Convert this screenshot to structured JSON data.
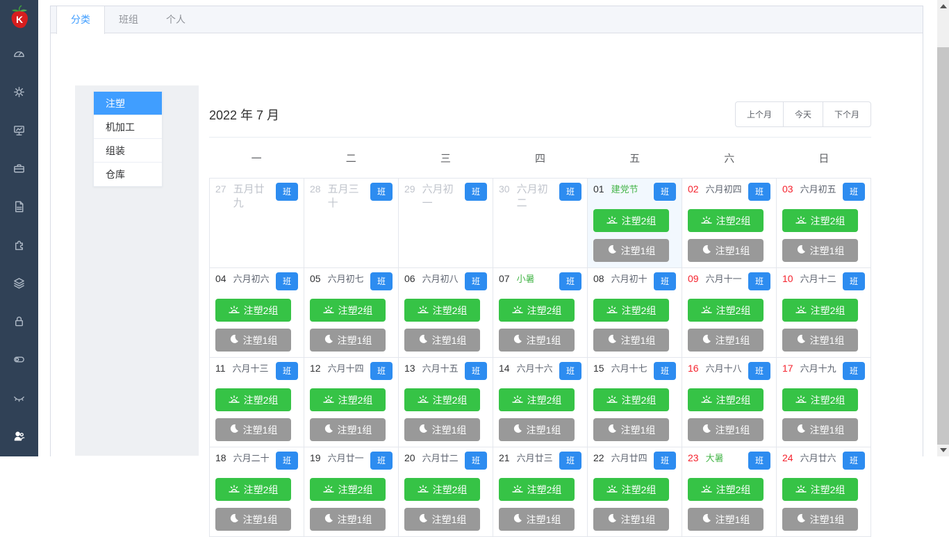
{
  "app": {
    "logo": "strawberry-logo"
  },
  "sidebar": {
    "icons": [
      {
        "name": "dashboard"
      },
      {
        "name": "settings"
      },
      {
        "name": "monitor-chart"
      },
      {
        "name": "toolbox"
      },
      {
        "name": "document"
      },
      {
        "name": "puzzle"
      },
      {
        "name": "layers"
      },
      {
        "name": "lock"
      },
      {
        "name": "toggle"
      },
      {
        "name": "eye-closed"
      },
      {
        "name": "users",
        "emphasis": true
      }
    ]
  },
  "tabs": [
    {
      "id": "category",
      "label": "分类",
      "active": true
    },
    {
      "id": "team",
      "label": "班组",
      "active": false
    },
    {
      "id": "personal",
      "label": "个人",
      "active": false
    }
  ],
  "categories": [
    {
      "label": "注塑",
      "active": true
    },
    {
      "label": "机加工",
      "active": false
    },
    {
      "label": "组装",
      "active": false
    },
    {
      "label": "仓库",
      "active": false
    }
  ],
  "calendar": {
    "title": "2022 年 7 月",
    "controls": {
      "prev": "上个月",
      "today": "今天",
      "next": "下个月"
    },
    "weekdays": [
      "一",
      "二",
      "三",
      "四",
      "五",
      "六",
      "日"
    ],
    "badge_label": "班",
    "shifts": {
      "day": "注塑2组",
      "night": "注塑1组",
      "day_icon": "sunrise-icon",
      "night_icon": "moon-icon"
    },
    "cells": [
      {
        "day": "27",
        "lunar": "五月廿九",
        "prev": true
      },
      {
        "day": "28",
        "lunar": "五月三十",
        "prev": true
      },
      {
        "day": "29",
        "lunar": "六月初一",
        "prev": true
      },
      {
        "day": "30",
        "lunar": "六月初二",
        "prev": true
      },
      {
        "day": "01",
        "lunar": "建党节",
        "festival": true,
        "today": true,
        "shifts": true
      },
      {
        "day": "02",
        "lunar": "六月初四",
        "red": true,
        "shifts": true
      },
      {
        "day": "03",
        "lunar": "六月初五",
        "red": true,
        "shifts": true
      },
      {
        "day": "04",
        "lunar": "六月初六",
        "shifts": true
      },
      {
        "day": "05",
        "lunar": "六月初七",
        "shifts": true
      },
      {
        "day": "06",
        "lunar": "六月初八",
        "shifts": true
      },
      {
        "day": "07",
        "lunar": "小暑",
        "festival": true,
        "shifts": true
      },
      {
        "day": "08",
        "lunar": "六月初十",
        "shifts": true
      },
      {
        "day": "09",
        "lunar": "六月十一",
        "red": true,
        "shifts": true
      },
      {
        "day": "10",
        "lunar": "六月十二",
        "red": true,
        "shifts": true
      },
      {
        "day": "11",
        "lunar": "六月十三",
        "shifts": true
      },
      {
        "day": "12",
        "lunar": "六月十四",
        "shifts": true
      },
      {
        "day": "13",
        "lunar": "六月十五",
        "shifts": true
      },
      {
        "day": "14",
        "lunar": "六月十六",
        "shifts": true
      },
      {
        "day": "15",
        "lunar": "六月十七",
        "shifts": true
      },
      {
        "day": "16",
        "lunar": "六月十八",
        "red": true,
        "shifts": true
      },
      {
        "day": "17",
        "lunar": "六月十九",
        "red": true,
        "shifts": true
      },
      {
        "day": "18",
        "lunar": "六月二十",
        "shifts": true
      },
      {
        "day": "19",
        "lunar": "六月廿一",
        "shifts": true
      },
      {
        "day": "20",
        "lunar": "六月廿二",
        "shifts": true
      },
      {
        "day": "21",
        "lunar": "六月廿三",
        "shifts": true
      },
      {
        "day": "22",
        "lunar": "六月廿四",
        "shifts": true
      },
      {
        "day": "23",
        "lunar": "大暑",
        "red": true,
        "festival": true,
        "shifts": true
      },
      {
        "day": "24",
        "lunar": "六月廿六",
        "red": true,
        "shifts": true
      }
    ]
  },
  "colors": {
    "sidebar_bg": "#304156",
    "accent_blue": "#2d8cf0",
    "tab_active_blue": "#409eff",
    "day_shift_green": "#36c346",
    "night_shift_gray": "#999999",
    "weekend_red": "#f5222d",
    "festival_green": "#45b549",
    "today_bg": "#f2f8fe"
  }
}
